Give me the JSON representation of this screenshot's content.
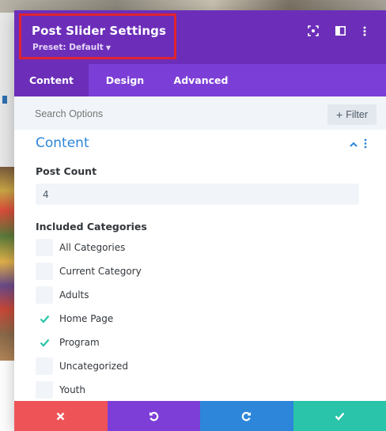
{
  "modal": {
    "title": "Post Slider Settings",
    "preset": "Preset: Default",
    "header_icons": [
      "focus-icon",
      "split-view-icon",
      "more-vertical-icon"
    ]
  },
  "tabs": [
    {
      "label": "Content",
      "active": true
    },
    {
      "label": "Design",
      "active": false
    },
    {
      "label": "Advanced",
      "active": false
    }
  ],
  "search": {
    "placeholder": "Search Options",
    "filter_label": "Filter"
  },
  "section": {
    "title": "Content",
    "expanded": true
  },
  "post_count": {
    "label": "Post Count",
    "value": "4"
  },
  "categories": {
    "label": "Included Categories",
    "items": [
      {
        "label": "All Categories",
        "checked": false
      },
      {
        "label": "Current Category",
        "checked": false
      },
      {
        "label": "Adults",
        "checked": false
      },
      {
        "label": "Home Page",
        "checked": true
      },
      {
        "label": "Program",
        "checked": true
      },
      {
        "label": "Uncategorized",
        "checked": false
      },
      {
        "label": "Youth",
        "checked": false
      }
    ]
  },
  "footer": {
    "buttons": [
      {
        "name": "discard-button",
        "icon": "close-icon",
        "color": "#ee5457"
      },
      {
        "name": "undo-button",
        "icon": "undo-icon",
        "color": "#7d3ed8"
      },
      {
        "name": "redo-button",
        "icon": "redo-icon",
        "color": "#2d86d9"
      },
      {
        "name": "save-button",
        "icon": "check-icon",
        "color": "#29c4a9"
      }
    ]
  },
  "colors": {
    "header": "#6c2eb9",
    "tabbar": "#7b3ed6",
    "accent_blue": "#2b87da",
    "check_teal": "#29c4a9",
    "highlight_red": "#e0232e"
  }
}
